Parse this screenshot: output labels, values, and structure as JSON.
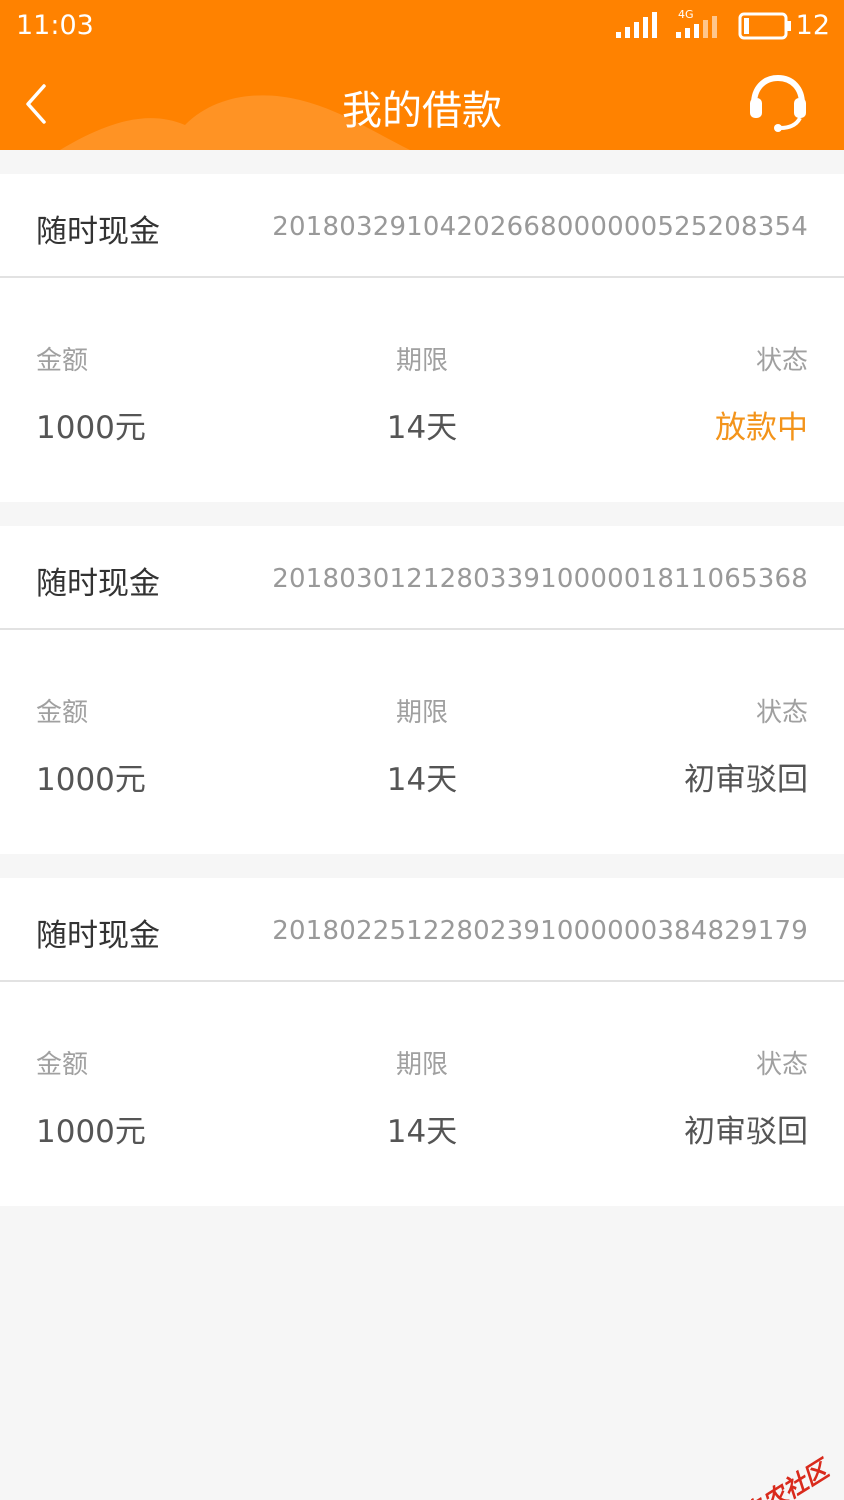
{
  "status_bar": {
    "time": "11:03",
    "battery": "12",
    "network": "4G"
  },
  "header": {
    "title": "我的借款",
    "back_icon": "chevron-left-icon",
    "service_icon": "headset-icon",
    "color": "#ff8200"
  },
  "loans": [
    {
      "product": "随时现金",
      "order_no": "20180329104202668000000525208354",
      "labels": {
        "amount": "金额",
        "term": "期限",
        "status": "状态"
      },
      "amount": "1000元",
      "term": "14天",
      "status": "放款中",
      "status_color": "#f3941b"
    },
    {
      "product": "随时现金",
      "order_no": "20180301212803391000001811065368",
      "labels": {
        "amount": "金额",
        "term": "期限",
        "status": "状态"
      },
      "amount": "1000元",
      "term": "14天",
      "status": "初审驳回",
      "status_color": "#555555"
    },
    {
      "product": "随时现金",
      "order_no": "20180225122802391000000384829179",
      "labels": {
        "amount": "金额",
        "term": "期限",
        "status": "状态"
      },
      "amount": "1000元",
      "term": "14天",
      "status": "初审驳回",
      "status_color": "#555555"
    }
  ],
  "watermark": {
    "text": "卡农社区"
  }
}
